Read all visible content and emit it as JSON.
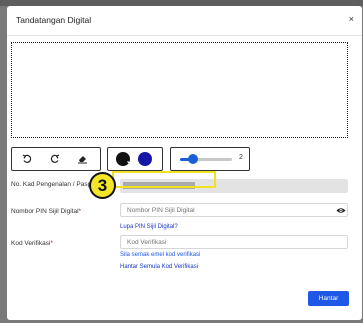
{
  "modal": {
    "title": "Tandatangan Digital",
    "close_symbol": "×"
  },
  "toolbar": {
    "undo_icon": "undo-icon",
    "redo_icon": "redo-icon",
    "eraser_icon": "eraser-icon",
    "colors": [
      "#111111",
      "#1515a8"
    ],
    "selected_color": "#111111",
    "pen_size": "2",
    "pen_size_fraction": 0.25
  },
  "form": {
    "id_label": "No. Kad Pengenalan / Pasport",
    "id_required": "*",
    "pin_label": "Nombor PIN Sijil Digital",
    "pin_required": "*",
    "pin_placeholder": "Nombor PIN Sijil Digital",
    "forgot_pin": "Lupa PIN Sijil Digital?",
    "code_label": "Kod Verifikasi",
    "code_required": "*",
    "code_placeholder": "Kod Verifikasi",
    "check_email": "Sila semak emel kod verifikasi",
    "resend_code": "Hantar Semula Kod Verifikasi",
    "submit_label": "Hantar"
  },
  "annotation": {
    "step_number": "3",
    "highlight_color": "#f0e21f"
  }
}
